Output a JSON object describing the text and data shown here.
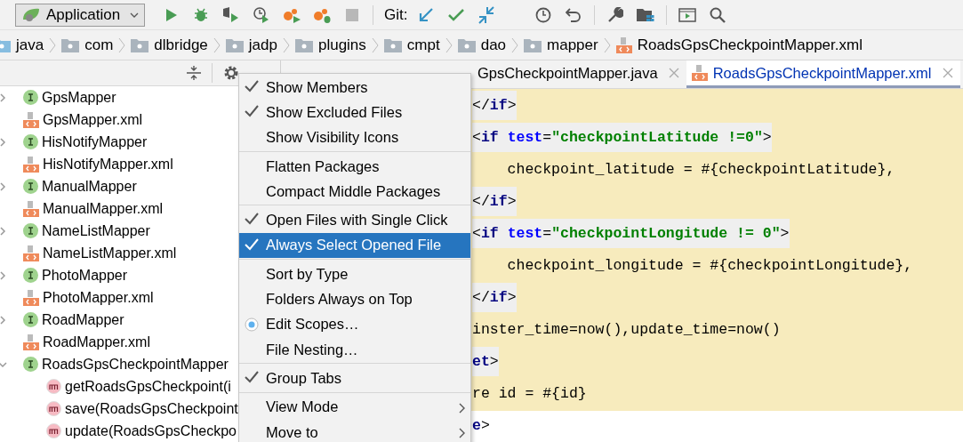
{
  "toolbar": {
    "run_config": "Application",
    "git_label": "Git:"
  },
  "breadcrumbs": [
    {
      "label": "java",
      "kind": "folder"
    },
    {
      "label": "com",
      "kind": "folder"
    },
    {
      "label": "dlbridge",
      "kind": "folder"
    },
    {
      "label": "jadp",
      "kind": "folder"
    },
    {
      "label": "plugins",
      "kind": "folder"
    },
    {
      "label": "cmpt",
      "kind": "folder"
    },
    {
      "label": "dao",
      "kind": "folder"
    },
    {
      "label": "mapper",
      "kind": "folder"
    },
    {
      "label": "RoadsGpsCheckpointMapper.xml",
      "kind": "xml"
    }
  ],
  "project_tree": [
    {
      "label": "GpsMapper",
      "kind": "interface",
      "expanded": false
    },
    {
      "label": "GpsMapper.xml",
      "kind": "xml"
    },
    {
      "label": "HisNotifyMapper",
      "kind": "interface",
      "expanded": false
    },
    {
      "label": "HisNotifyMapper.xml",
      "kind": "xml"
    },
    {
      "label": "ManualMapper",
      "kind": "interface",
      "expanded": false
    },
    {
      "label": "ManualMapper.xml",
      "kind": "xml"
    },
    {
      "label": "NameListMapper",
      "kind": "interface",
      "expanded": false
    },
    {
      "label": "NameListMapper.xml",
      "kind": "xml"
    },
    {
      "label": "PhotoMapper",
      "kind": "interface",
      "expanded": false
    },
    {
      "label": "PhotoMapper.xml",
      "kind": "xml"
    },
    {
      "label": "RoadMapper",
      "kind": "interface",
      "expanded": false
    },
    {
      "label": "RoadMapper.xml",
      "kind": "xml"
    },
    {
      "label": "RoadsGpsCheckpointMapper",
      "kind": "interface",
      "expanded": true,
      "children": [
        {
          "label": "getRoadsGpsCheckpoint(i",
          "kind": "method"
        },
        {
          "label": "save(RoadsGpsCheckpoint",
          "kind": "method"
        },
        {
          "label": "update(RoadsGpsCheckpo",
          "kind": "method"
        }
      ]
    }
  ],
  "editor_tabs": [
    {
      "label": "GpsCheckpointMapper.java",
      "kind": "java",
      "selected": false
    },
    {
      "label": "RoadsGpsCheckpointMapper.xml",
      "kind": "xml",
      "selected": true
    }
  ],
  "code_lines": [
    {
      "kind": "tag",
      "tokens": [
        {
          "kind": "text",
          "text": "</"
        },
        {
          "kind": "tag",
          "text": "if"
        },
        {
          "kind": "text",
          "text": ">"
        }
      ]
    },
    {
      "kind": "tag",
      "tokens": [
        {
          "kind": "text",
          "text": "<"
        },
        {
          "kind": "tag",
          "text": "if "
        },
        {
          "kind": "attr",
          "text": "test"
        },
        {
          "kind": "text",
          "text": "="
        },
        {
          "kind": "value",
          "text": "\"checkpointLatitude !=0\""
        },
        {
          "kind": "text",
          "text": ">"
        }
      ]
    },
    {
      "kind": "plain",
      "tokens": [
        {
          "kind": "text",
          "text": "    checkpoint_latitude = #{checkpointLatitude},"
        }
      ]
    },
    {
      "kind": "tag",
      "tokens": [
        {
          "kind": "text",
          "text": "</"
        },
        {
          "kind": "tag",
          "text": "if"
        },
        {
          "kind": "text",
          "text": ">"
        }
      ]
    },
    {
      "kind": "tag",
      "tokens": [
        {
          "kind": "text",
          "text": "<"
        },
        {
          "kind": "tag",
          "text": "if "
        },
        {
          "kind": "attr",
          "text": "test"
        },
        {
          "kind": "text",
          "text": "="
        },
        {
          "kind": "value",
          "text": "\"checkpointLongitude != 0\""
        },
        {
          "kind": "text",
          "text": ">"
        }
      ]
    },
    {
      "kind": "plain",
      "tokens": [
        {
          "kind": "text",
          "text": "    checkpoint_longitude = #{checkpointLongitude},"
        }
      ]
    },
    {
      "kind": "tag",
      "tokens": [
        {
          "kind": "text",
          "text": "</"
        },
        {
          "kind": "tag",
          "text": "if"
        },
        {
          "kind": "text",
          "text": ">"
        }
      ]
    },
    {
      "kind": "plain",
      "tokens": [
        {
          "kind": "text",
          "text": "inster_time=now(),update_time=now()"
        }
      ]
    },
    {
      "kind": "tag",
      "tokens": [
        {
          "kind": "tag",
          "text": "et"
        },
        {
          "kind": "text",
          "text": ">"
        }
      ]
    },
    {
      "kind": "plain",
      "tokens": [
        {
          "kind": "text",
          "text": "re id = #{id}"
        }
      ]
    },
    {
      "kind": "outside",
      "tokens": [
        {
          "kind": "tag",
          "text": "e"
        },
        {
          "kind": "text",
          "text": ">"
        }
      ]
    }
  ],
  "context_menu": [
    [
      {
        "label": "Show Members",
        "kind": "check",
        "checked": true,
        "selected": false
      },
      {
        "label": "Show Excluded Files",
        "kind": "check",
        "checked": true,
        "selected": false
      },
      {
        "label": "Show Visibility Icons",
        "kind": "check",
        "checked": false,
        "selected": false
      }
    ],
    [
      {
        "label": "Flatten Packages",
        "kind": "check",
        "checked": false,
        "selected": false
      },
      {
        "label": "Compact Middle Packages",
        "kind": "check",
        "checked": false,
        "selected": false
      }
    ],
    [
      {
        "label": "Open Files with Single Click",
        "kind": "check",
        "checked": true,
        "selected": false
      },
      {
        "label": "Always Select Opened File",
        "kind": "check",
        "checked": true,
        "selected": true
      }
    ],
    [
      {
        "label": "Sort by Type",
        "kind": "check",
        "checked": false,
        "selected": false
      },
      {
        "label": "Folders Always on Top",
        "kind": "check",
        "checked": false,
        "selected": false
      },
      {
        "label": "Edit Scopes…",
        "kind": "radio",
        "checked": true,
        "selected": false
      },
      {
        "label": "File Nesting…",
        "kind": "check",
        "checked": false,
        "selected": false
      }
    ],
    [
      {
        "label": "Group Tabs",
        "kind": "check",
        "checked": true,
        "selected": false
      }
    ],
    [
      {
        "label": "View Mode",
        "kind": "submenu",
        "selected": false
      },
      {
        "label": "Move to",
        "kind": "submenu",
        "selected": false
      }
    ]
  ]
}
